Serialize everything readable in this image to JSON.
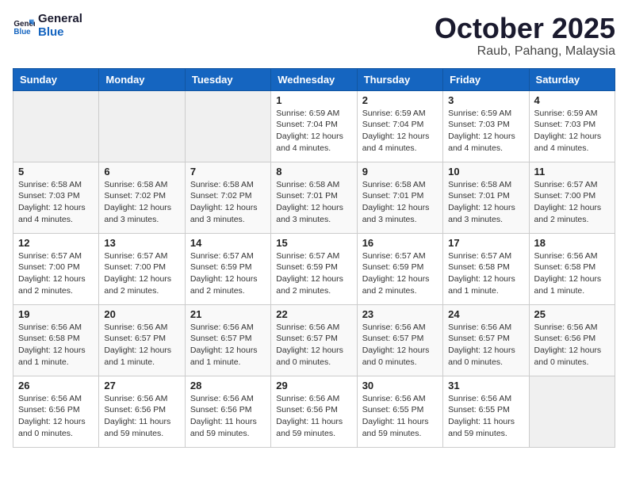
{
  "header": {
    "logo_line1": "General",
    "logo_line2": "Blue",
    "month_title": "October 2025",
    "location": "Raub, Pahang, Malaysia"
  },
  "weekdays": [
    "Sunday",
    "Monday",
    "Tuesday",
    "Wednesday",
    "Thursday",
    "Friday",
    "Saturday"
  ],
  "weeks": [
    [
      {
        "day": "",
        "sunrise": "",
        "sunset": "",
        "daylight": "",
        "empty": true
      },
      {
        "day": "",
        "sunrise": "",
        "sunset": "",
        "daylight": "",
        "empty": true
      },
      {
        "day": "",
        "sunrise": "",
        "sunset": "",
        "daylight": "",
        "empty": true
      },
      {
        "day": "1",
        "sunrise": "Sunrise: 6:59 AM",
        "sunset": "Sunset: 7:04 PM",
        "daylight": "Daylight: 12 hours and 4 minutes."
      },
      {
        "day": "2",
        "sunrise": "Sunrise: 6:59 AM",
        "sunset": "Sunset: 7:04 PM",
        "daylight": "Daylight: 12 hours and 4 minutes."
      },
      {
        "day": "3",
        "sunrise": "Sunrise: 6:59 AM",
        "sunset": "Sunset: 7:03 PM",
        "daylight": "Daylight: 12 hours and 4 minutes."
      },
      {
        "day": "4",
        "sunrise": "Sunrise: 6:59 AM",
        "sunset": "Sunset: 7:03 PM",
        "daylight": "Daylight: 12 hours and 4 minutes."
      }
    ],
    [
      {
        "day": "5",
        "sunrise": "Sunrise: 6:58 AM",
        "sunset": "Sunset: 7:03 PM",
        "daylight": "Daylight: 12 hours and 4 minutes."
      },
      {
        "day": "6",
        "sunrise": "Sunrise: 6:58 AM",
        "sunset": "Sunset: 7:02 PM",
        "daylight": "Daylight: 12 hours and 3 minutes."
      },
      {
        "day": "7",
        "sunrise": "Sunrise: 6:58 AM",
        "sunset": "Sunset: 7:02 PM",
        "daylight": "Daylight: 12 hours and 3 minutes."
      },
      {
        "day": "8",
        "sunrise": "Sunrise: 6:58 AM",
        "sunset": "Sunset: 7:01 PM",
        "daylight": "Daylight: 12 hours and 3 minutes."
      },
      {
        "day": "9",
        "sunrise": "Sunrise: 6:58 AM",
        "sunset": "Sunset: 7:01 PM",
        "daylight": "Daylight: 12 hours and 3 minutes."
      },
      {
        "day": "10",
        "sunrise": "Sunrise: 6:58 AM",
        "sunset": "Sunset: 7:01 PM",
        "daylight": "Daylight: 12 hours and 3 minutes."
      },
      {
        "day": "11",
        "sunrise": "Sunrise: 6:57 AM",
        "sunset": "Sunset: 7:00 PM",
        "daylight": "Daylight: 12 hours and 2 minutes."
      }
    ],
    [
      {
        "day": "12",
        "sunrise": "Sunrise: 6:57 AM",
        "sunset": "Sunset: 7:00 PM",
        "daylight": "Daylight: 12 hours and 2 minutes."
      },
      {
        "day": "13",
        "sunrise": "Sunrise: 6:57 AM",
        "sunset": "Sunset: 7:00 PM",
        "daylight": "Daylight: 12 hours and 2 minutes."
      },
      {
        "day": "14",
        "sunrise": "Sunrise: 6:57 AM",
        "sunset": "Sunset: 6:59 PM",
        "daylight": "Daylight: 12 hours and 2 minutes."
      },
      {
        "day": "15",
        "sunrise": "Sunrise: 6:57 AM",
        "sunset": "Sunset: 6:59 PM",
        "daylight": "Daylight: 12 hours and 2 minutes."
      },
      {
        "day": "16",
        "sunrise": "Sunrise: 6:57 AM",
        "sunset": "Sunset: 6:59 PM",
        "daylight": "Daylight: 12 hours and 2 minutes."
      },
      {
        "day": "17",
        "sunrise": "Sunrise: 6:57 AM",
        "sunset": "Sunset: 6:58 PM",
        "daylight": "Daylight: 12 hours and 1 minute."
      },
      {
        "day": "18",
        "sunrise": "Sunrise: 6:56 AM",
        "sunset": "Sunset: 6:58 PM",
        "daylight": "Daylight: 12 hours and 1 minute."
      }
    ],
    [
      {
        "day": "19",
        "sunrise": "Sunrise: 6:56 AM",
        "sunset": "Sunset: 6:58 PM",
        "daylight": "Daylight: 12 hours and 1 minute."
      },
      {
        "day": "20",
        "sunrise": "Sunrise: 6:56 AM",
        "sunset": "Sunset: 6:57 PM",
        "daylight": "Daylight: 12 hours and 1 minute."
      },
      {
        "day": "21",
        "sunrise": "Sunrise: 6:56 AM",
        "sunset": "Sunset: 6:57 PM",
        "daylight": "Daylight: 12 hours and 1 minute."
      },
      {
        "day": "22",
        "sunrise": "Sunrise: 6:56 AM",
        "sunset": "Sunset: 6:57 PM",
        "daylight": "Daylight: 12 hours and 0 minutes."
      },
      {
        "day": "23",
        "sunrise": "Sunrise: 6:56 AM",
        "sunset": "Sunset: 6:57 PM",
        "daylight": "Daylight: 12 hours and 0 minutes."
      },
      {
        "day": "24",
        "sunrise": "Sunrise: 6:56 AM",
        "sunset": "Sunset: 6:57 PM",
        "daylight": "Daylight: 12 hours and 0 minutes."
      },
      {
        "day": "25",
        "sunrise": "Sunrise: 6:56 AM",
        "sunset": "Sunset: 6:56 PM",
        "daylight": "Daylight: 12 hours and 0 minutes."
      }
    ],
    [
      {
        "day": "26",
        "sunrise": "Sunrise: 6:56 AM",
        "sunset": "Sunset: 6:56 PM",
        "daylight": "Daylight: 12 hours and 0 minutes."
      },
      {
        "day": "27",
        "sunrise": "Sunrise: 6:56 AM",
        "sunset": "Sunset: 6:56 PM",
        "daylight": "Daylight: 11 hours and 59 minutes."
      },
      {
        "day": "28",
        "sunrise": "Sunrise: 6:56 AM",
        "sunset": "Sunset: 6:56 PM",
        "daylight": "Daylight: 11 hours and 59 minutes."
      },
      {
        "day": "29",
        "sunrise": "Sunrise: 6:56 AM",
        "sunset": "Sunset: 6:56 PM",
        "daylight": "Daylight: 11 hours and 59 minutes."
      },
      {
        "day": "30",
        "sunrise": "Sunrise: 6:56 AM",
        "sunset": "Sunset: 6:55 PM",
        "daylight": "Daylight: 11 hours and 59 minutes."
      },
      {
        "day": "31",
        "sunrise": "Sunrise: 6:56 AM",
        "sunset": "Sunset: 6:55 PM",
        "daylight": "Daylight: 11 hours and 59 minutes."
      },
      {
        "day": "",
        "sunrise": "",
        "sunset": "",
        "daylight": "",
        "empty": true
      }
    ]
  ]
}
